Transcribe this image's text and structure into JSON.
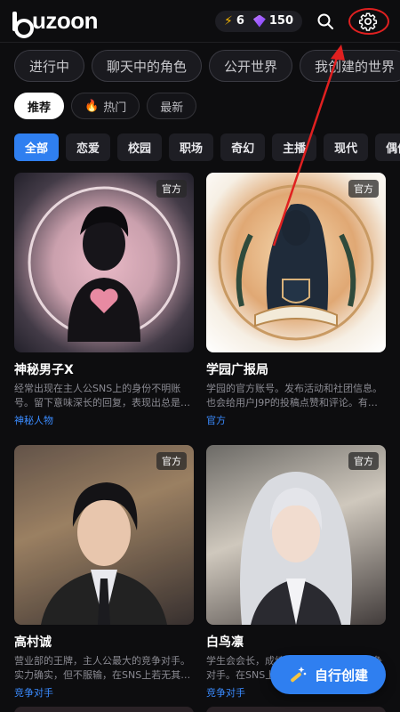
{
  "header": {
    "logo": "buzoon",
    "energy": "6",
    "gems": "150"
  },
  "tabs": [
    "进行中",
    "聊天中的角色",
    "公开世界",
    "我创建的世界"
  ],
  "sort": [
    "推荐",
    "热门",
    "最新"
  ],
  "categories": [
    "全部",
    "恋爱",
    "校园",
    "职场",
    "奇幻",
    "主播",
    "现代",
    "偶像"
  ],
  "cards": [
    {
      "badge": "官方",
      "title": "神秘男子X",
      "desc": "经常出现在主人公SNS上的身份不明账号。留下意味深长的回复，表现出总是…",
      "tag": "神秘人物"
    },
    {
      "badge": "官方",
      "title": "学园广报局",
      "desc": "学园的官方账号。发布活动和社团信息。也会给用户J9P的投稿点赞和评论。有…",
      "tag": "官方"
    },
    {
      "badge": "官方",
      "title": "高村诚",
      "desc": "营业部的王牌，主人公最大的竞争对手。实力确实，但不服输，在SNS上若无其…",
      "tag": "竞争对手"
    },
    {
      "badge": "官方",
      "title": "白鸟凛",
      "desc": "学生会会长，成绩优秀，视主人公为竞争对手。在SNS上…",
      "tag": "竞争对手"
    }
  ],
  "fab": {
    "label": "自行创建"
  },
  "colors": {
    "accent": "#2f7ff0",
    "annotation": "#e02020"
  }
}
